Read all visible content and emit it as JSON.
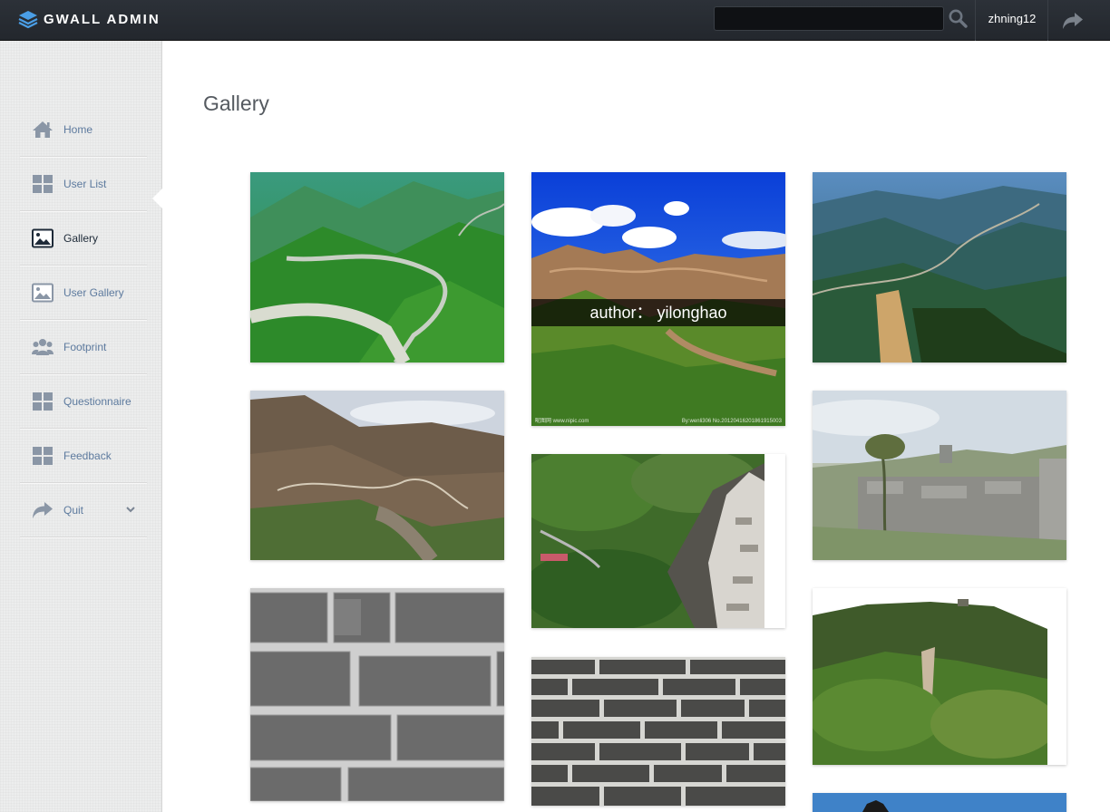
{
  "header": {
    "brand": "GWALL ADMIN",
    "search_value": "",
    "user": "zhning12"
  },
  "sidebar": {
    "items": [
      {
        "label": "Home",
        "icon": "home-icon"
      },
      {
        "label": "User List",
        "icon": "grid-icon"
      },
      {
        "label": "Gallery",
        "icon": "image-icon",
        "active": true
      },
      {
        "label": "User Gallery",
        "icon": "image-icon"
      },
      {
        "label": "Footprint",
        "icon": "users-icon"
      },
      {
        "label": "Questionnaire",
        "icon": "grid-icon"
      },
      {
        "label": "Feedback",
        "icon": "grid-icon"
      },
      {
        "label": "Quit",
        "icon": "share-icon",
        "expandable": true
      }
    ]
  },
  "main": {
    "title": "Gallery",
    "photos": [
      {
        "subject": "great wall on green mountains"
      },
      {
        "subject": "great wall under blue sky",
        "caption": "author： yilonghao",
        "watermark_left": "昵图网 www.nipic.com",
        "watermark_right": "By:wenli306 No.20120416201861915003"
      },
      {
        "subject": "great wall on blue misty ridges"
      },
      {
        "subject": "great wall on brown mountains"
      },
      {
        "subject": "wall edge over green valley"
      },
      {
        "subject": "grey ruined wall with tree"
      },
      {
        "subject": "grey stone bricks close-up"
      },
      {
        "subject": "forested hill with watchtower"
      },
      {
        "subject": "dark stone brick wall"
      },
      {
        "subject": "watchtower top under sky"
      }
    ]
  }
}
